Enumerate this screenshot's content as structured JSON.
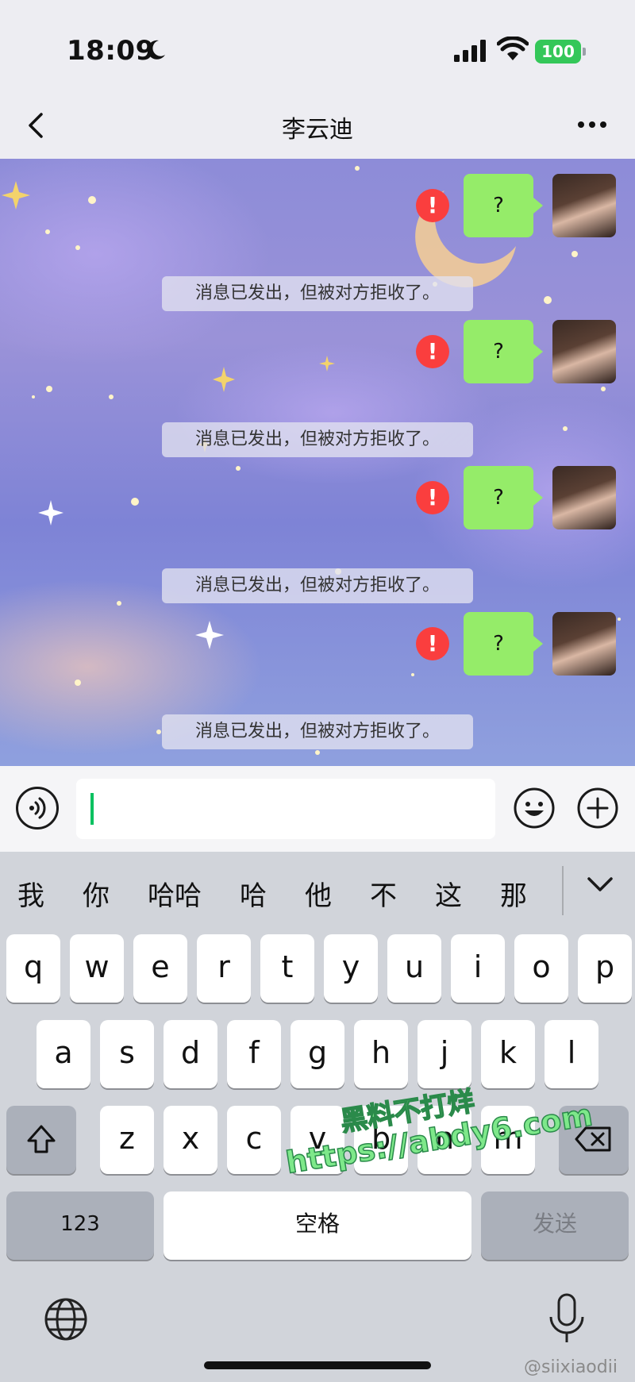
{
  "status": {
    "time": "18:09",
    "battery": "100"
  },
  "header": {
    "title": "李云迪"
  },
  "messages": [
    {
      "text": "?",
      "system": "消息已发出，但被对方拒收了。"
    },
    {
      "text": "?",
      "system": "消息已发出，但被对方拒收了。"
    },
    {
      "text": "?",
      "system": "消息已发出，但被对方拒收了。"
    },
    {
      "text": "?",
      "system": "消息已发出，但被对方拒收了。"
    }
  ],
  "error_mark": "!",
  "input": {
    "value": ""
  },
  "keyboard": {
    "candidates": [
      "我",
      "你",
      "哈哈",
      "哈",
      "他",
      "不",
      "这",
      "那"
    ],
    "row1": [
      "q",
      "w",
      "e",
      "r",
      "t",
      "y",
      "u",
      "i",
      "o",
      "p"
    ],
    "row2": [
      "a",
      "s",
      "d",
      "f",
      "g",
      "h",
      "j",
      "k",
      "l"
    ],
    "row3": [
      "z",
      "x",
      "c",
      "v",
      "b",
      "n",
      "m"
    ],
    "numbers_label": "123",
    "space_label": "空格",
    "send_label": "发送"
  },
  "watermark": {
    "line1": "黑料不打烊",
    "line2": "https://abdy6.com"
  },
  "credit": "@siixiaodii",
  "colors": {
    "bubble": "#95ec69",
    "error": "#fa3e3e",
    "cursor": "#07c160",
    "battery": "#34c759"
  }
}
